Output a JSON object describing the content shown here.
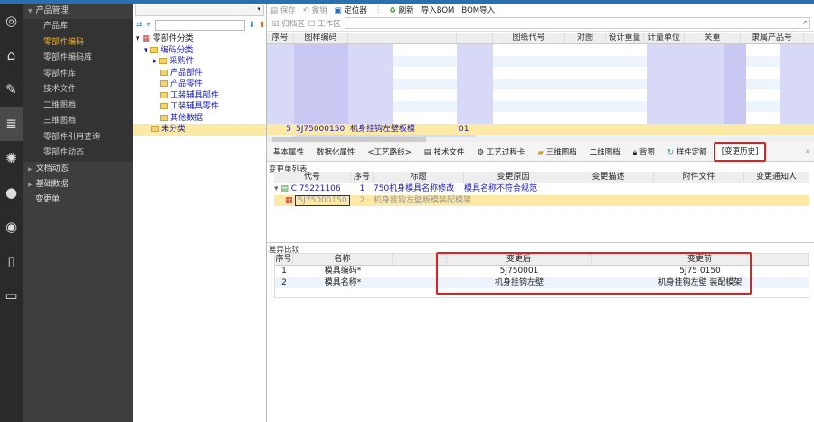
{
  "rail": {
    "icons": [
      "logo-icon",
      "home-icon",
      "edit-icon",
      "database-icon",
      "loading-icon",
      "chat-icon",
      "signal-icon",
      "book-icon",
      "id-card-icon"
    ]
  },
  "menu": {
    "group": "产品管理",
    "items": [
      "产品库",
      "零部件编码",
      "零部件编码库",
      "零部件库",
      "技术文件",
      "二维图档",
      "三维图档",
      "零部件引用查询",
      "零部件动态"
    ],
    "selected": "零部件编码",
    "groups": [
      "文档动态",
      "基础数据"
    ],
    "extra": "变更单"
  },
  "tree": {
    "root": "零部件分类",
    "nodes": [
      "编码分类",
      "采购件",
      "产品部件",
      "产品零件",
      "工装辅具部件",
      "工装辅具零件",
      "其他数据"
    ],
    "unclassified": "未分类"
  },
  "toolbar": {
    "save": "保存",
    "undo": "撤销",
    "locator": "定位器",
    "refresh": "刷新",
    "import_bom": "导入BOM",
    "bom_import": "BOM导入"
  },
  "filters": {
    "archive": "归档区",
    "work": "工作区"
  },
  "grid": {
    "headers": [
      "序号",
      "图样编码",
      "",
      "",
      "图纸代号",
      "对图",
      "设计重量",
      "计量单位",
      "关重",
      "隶属产品号"
    ],
    "selected_row": {
      "index": "5",
      "code": "5J75000150",
      "name": "机身挂钩左壁板模",
      "ver": "01"
    }
  },
  "tabs": [
    "基本属性",
    "数据化属性",
    "<工艺路线>",
    "技术文件",
    "工艺过程卡",
    "三维图档",
    "二维图档",
    "背图",
    "样件定额",
    "[变更历史]"
  ],
  "change_list": {
    "title": "变更单列表",
    "headers": [
      "代号",
      "序号",
      "标题",
      "变更原因",
      "变更描述",
      "附件文件",
      "变更通知人"
    ],
    "rows": [
      {
        "code": "CJ75221106",
        "no": "1",
        "title": "750机身模具名称修改",
        "reason": "模具名称不符合规范"
      },
      {
        "code": "5J75000150",
        "no": "2",
        "title": "机身挂钩左壁板模装配模架"
      }
    ]
  },
  "diff": {
    "title": "差异比较",
    "headers": [
      "序号",
      "名称",
      "变更后",
      "变更前"
    ],
    "rows": [
      {
        "no": "1",
        "name": "模具编码*",
        "after": "5J750001",
        "before": "5J75    0150"
      },
      {
        "no": "2",
        "name": "模具名称*",
        "after": "机身挂钩左壁",
        "before": "机身挂钩左壁     装配模架"
      }
    ]
  }
}
